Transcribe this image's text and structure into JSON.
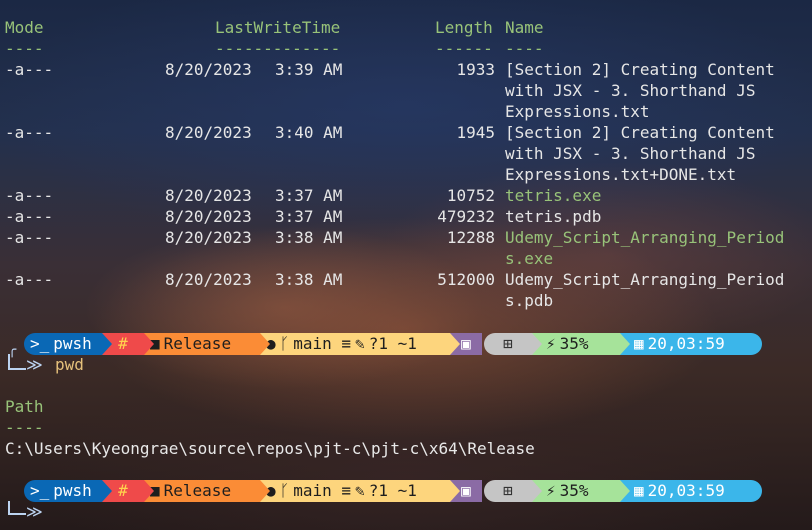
{
  "listing": {
    "headers": {
      "mode": "Mode",
      "time": "LastWriteTime",
      "length": "Length",
      "name": "Name"
    },
    "underlines": {
      "mode": "----",
      "time": "-------------",
      "length": "------",
      "name": "----"
    },
    "rows": [
      {
        "mode": "-a---",
        "date": "8/20/2023",
        "time": "3:39 AM",
        "length": "1933",
        "name_lines": [
          "[Section 2] Creating Content",
          "with JSX - 3. Shorthand JS",
          "Expressions.txt"
        ],
        "kind": "file"
      },
      {
        "mode": "-a---",
        "date": "8/20/2023",
        "time": "3:40 AM",
        "length": "1945",
        "name_lines": [
          "[Section 2] Creating Content",
          "with JSX - 3. Shorthand JS",
          "Expressions.txt+DONE.txt"
        ],
        "kind": "file"
      },
      {
        "mode": "-a---",
        "date": "8/20/2023",
        "time": "3:37 AM",
        "length": "10752",
        "name_lines": [
          "tetris.exe"
        ],
        "kind": "exe"
      },
      {
        "mode": "-a---",
        "date": "8/20/2023",
        "time": "3:37 AM",
        "length": "479232",
        "name_lines": [
          "tetris.pdb"
        ],
        "kind": "file"
      },
      {
        "mode": "-a---",
        "date": "8/20/2023",
        "time": "3:38 AM",
        "length": "12288",
        "name_lines": [
          "Udemy_Script_Arranging_Period",
          "s.exe"
        ],
        "kind": "exe"
      },
      {
        "mode": "-a---",
        "date": "8/20/2023",
        "time": "3:38 AM",
        "length": "512000",
        "name_lines": [
          "Udemy_Script_Arranging_Period",
          "s.pdb"
        ],
        "kind": "file"
      }
    ]
  },
  "prompt": {
    "shell": "pwsh",
    "hash": "#",
    "folder": "Release",
    "branch": "main ≡",
    "changes": "?1 ~1",
    "battery": "35%",
    "clock": "20,03:59",
    "prompt_glyph": "≫"
  },
  "command": "pwd",
  "pwd_output": {
    "header": "Path",
    "underline": "----",
    "path": "C:\\Users\\Kyeongrae\\source\\repos\\pjt-c\\pjt-c\\x64\\Release"
  },
  "colors": {
    "header_green": "#98c379",
    "pwsh_blue": "#0a68b5",
    "hash_red": "#ef4a4a",
    "folder_orange": "#fb8c36",
    "git_yellow": "#fdd57d",
    "os_grey": "#c5c5c5",
    "battery_green": "#a6e39a",
    "time_cyan": "#3bb6ea"
  },
  "icons": [
    "terminal-icon",
    "folder-icon",
    "github-icon",
    "branch-icon",
    "edit-icon",
    "executiontime-icon",
    "windows-icon",
    "plug-icon",
    "calendar-icon"
  ]
}
